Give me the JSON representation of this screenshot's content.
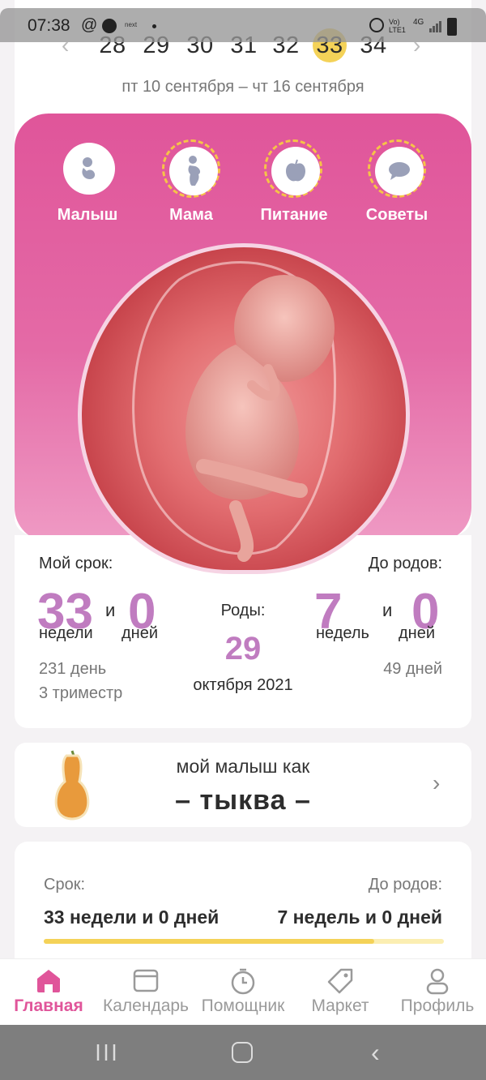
{
  "status_bar": {
    "time": "07:38",
    "network": "4G",
    "volte": "Vo) LTE1"
  },
  "week_selector": {
    "weeks": [
      "28",
      "29",
      "30",
      "31",
      "32",
      "33",
      "34"
    ],
    "selected": "33",
    "date_range": "пт 10 сентября – чт 16 сентября"
  },
  "categories": [
    {
      "label": "Малыш",
      "icon": "fetus-icon"
    },
    {
      "label": "Мама",
      "icon": "pregnant-woman-icon"
    },
    {
      "label": "Питание",
      "icon": "apple-icon"
    },
    {
      "label": "Советы",
      "icon": "speech-bubble-icon"
    }
  ],
  "term": {
    "my_term_label": "Мой срок:",
    "weeks_value": "33",
    "and": "и",
    "days_value": "0",
    "weeks_unit": "недели",
    "days_unit": "дней",
    "total_days": "231 день",
    "trimester": "3 триместр"
  },
  "birth": {
    "label": "Роды:",
    "day": "29",
    "month_year": "октября 2021"
  },
  "until_birth": {
    "label": "До родов:",
    "weeks_value": "7",
    "and": "и",
    "days_value": "0",
    "weeks_unit": "недель",
    "days_unit": "дней",
    "total_days": "49 дней"
  },
  "baby_size": {
    "title": "мой малыш как",
    "fruit": "– тыква –"
  },
  "progress": {
    "term_label": "Срок:",
    "term_value": "33 недели и 0 дней",
    "left_label": "До родов:",
    "left_value": "7 недель и 0 дней",
    "fraction": 0.825
  },
  "bottom_nav": [
    {
      "label": "Главная",
      "icon": "home-icon",
      "active": true
    },
    {
      "label": "Календарь",
      "icon": "calendar-icon",
      "active": false
    },
    {
      "label": "Помощник",
      "icon": "stopwatch-icon",
      "active": false
    },
    {
      "label": "Маркет",
      "icon": "tag-icon",
      "active": false
    },
    {
      "label": "Профиль",
      "icon": "user-icon",
      "active": false
    }
  ],
  "colors": {
    "accent_pink": "#e0559a",
    "accent_purple": "#c07cc0",
    "accent_yellow": "#f4d258"
  }
}
